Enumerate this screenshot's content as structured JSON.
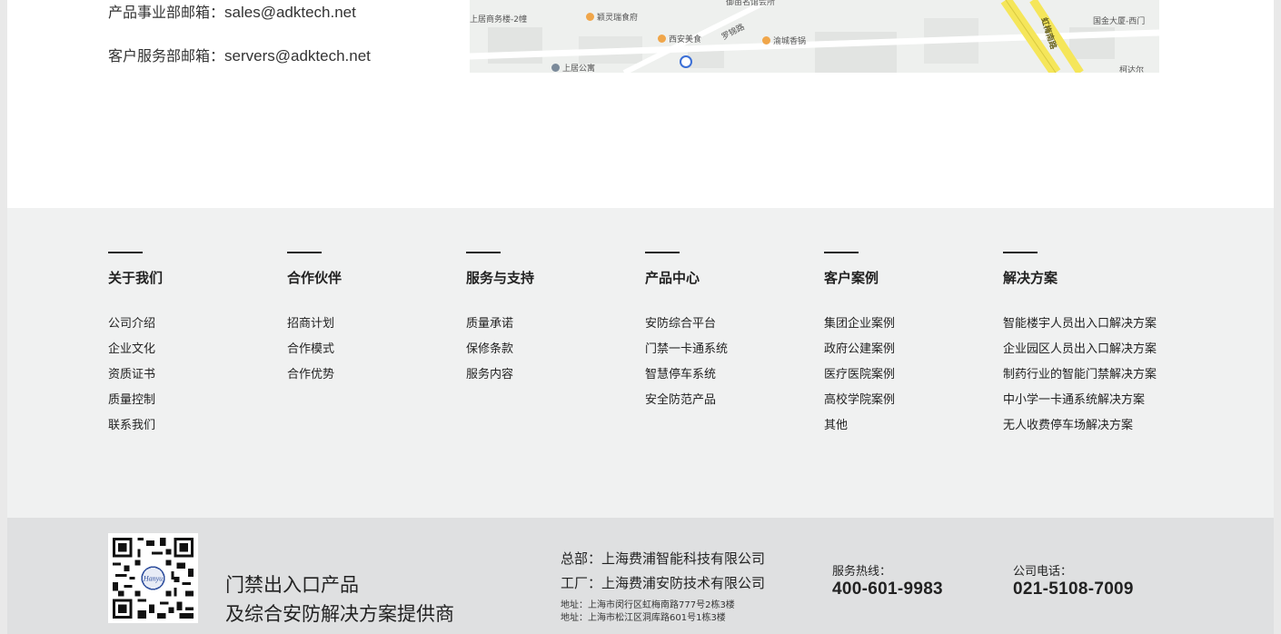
{
  "contact": {
    "sales": {
      "label": "产品事业部邮箱：",
      "email": "sales@adktech.net"
    },
    "service": {
      "label": "客户服务部邮箱：",
      "email": "servers@adktech.net"
    }
  },
  "map": {
    "labels": [
      "上居商务楼-2幢",
      "颖灵瑞食府",
      "西安美食",
      "罗锦路",
      "渝城香锅",
      "上居公寓",
      "虹梅南路",
      "国金大厦-西门",
      "柯达尔",
      "御苗名馆会所"
    ]
  },
  "footer_nav": {
    "columns": [
      {
        "title": "关于我们",
        "items": [
          "公司介绍",
          "企业文化",
          "资质证书",
          "质量控制",
          "联系我们"
        ]
      },
      {
        "title": "合作伙伴",
        "items": [
          "招商计划",
          "合作模式",
          "合作优势"
        ]
      },
      {
        "title": "服务与支持",
        "items": [
          "质量承诺",
          "保修条款",
          "服务内容"
        ]
      },
      {
        "title": "产品中心",
        "items": [
          "安防综合平台",
          "门禁一卡通系统",
          "智慧停车系统",
          "安全防范产品"
        ]
      },
      {
        "title": "客户案例",
        "items": [
          "集团企业案例",
          "政府公建案例",
          "医疗医院案例",
          "高校学院案例",
          "其他"
        ]
      },
      {
        "title": "解决方案",
        "items": [
          "智能楼宇人员出入口解决方案",
          "企业园区人员出入口解决方案",
          "制药行业的智能门禁解决方案",
          "中小学一卡通系统解决方案",
          "无人收费停车场解决方案"
        ]
      }
    ]
  },
  "bottom": {
    "tagline_1": "门禁出入口产品",
    "tagline_2": "及综合安防解决方案提供商",
    "hq": "总部：上海费浦智能科技有限公司",
    "factory": "工厂：上海费浦安防技术有限公司",
    "addr_1": "地址：上海市闵行区虹梅南路777号2栋3楼",
    "addr_2": "地址：上海市松江区洞库路601号1栋3楼",
    "hotline_label": "服务热线：",
    "hotline": "400-601-9983",
    "tel_label": "公司电话：",
    "tel": "021-5108-7009"
  },
  "colors": {
    "footer_bg": "#f0f1f1",
    "bottom_bg": "#dfe0e1",
    "map_road": "#f5e65a"
  },
  "icons": [
    "qr-code-icon",
    "map-pin-icon",
    "metro-icon"
  ]
}
